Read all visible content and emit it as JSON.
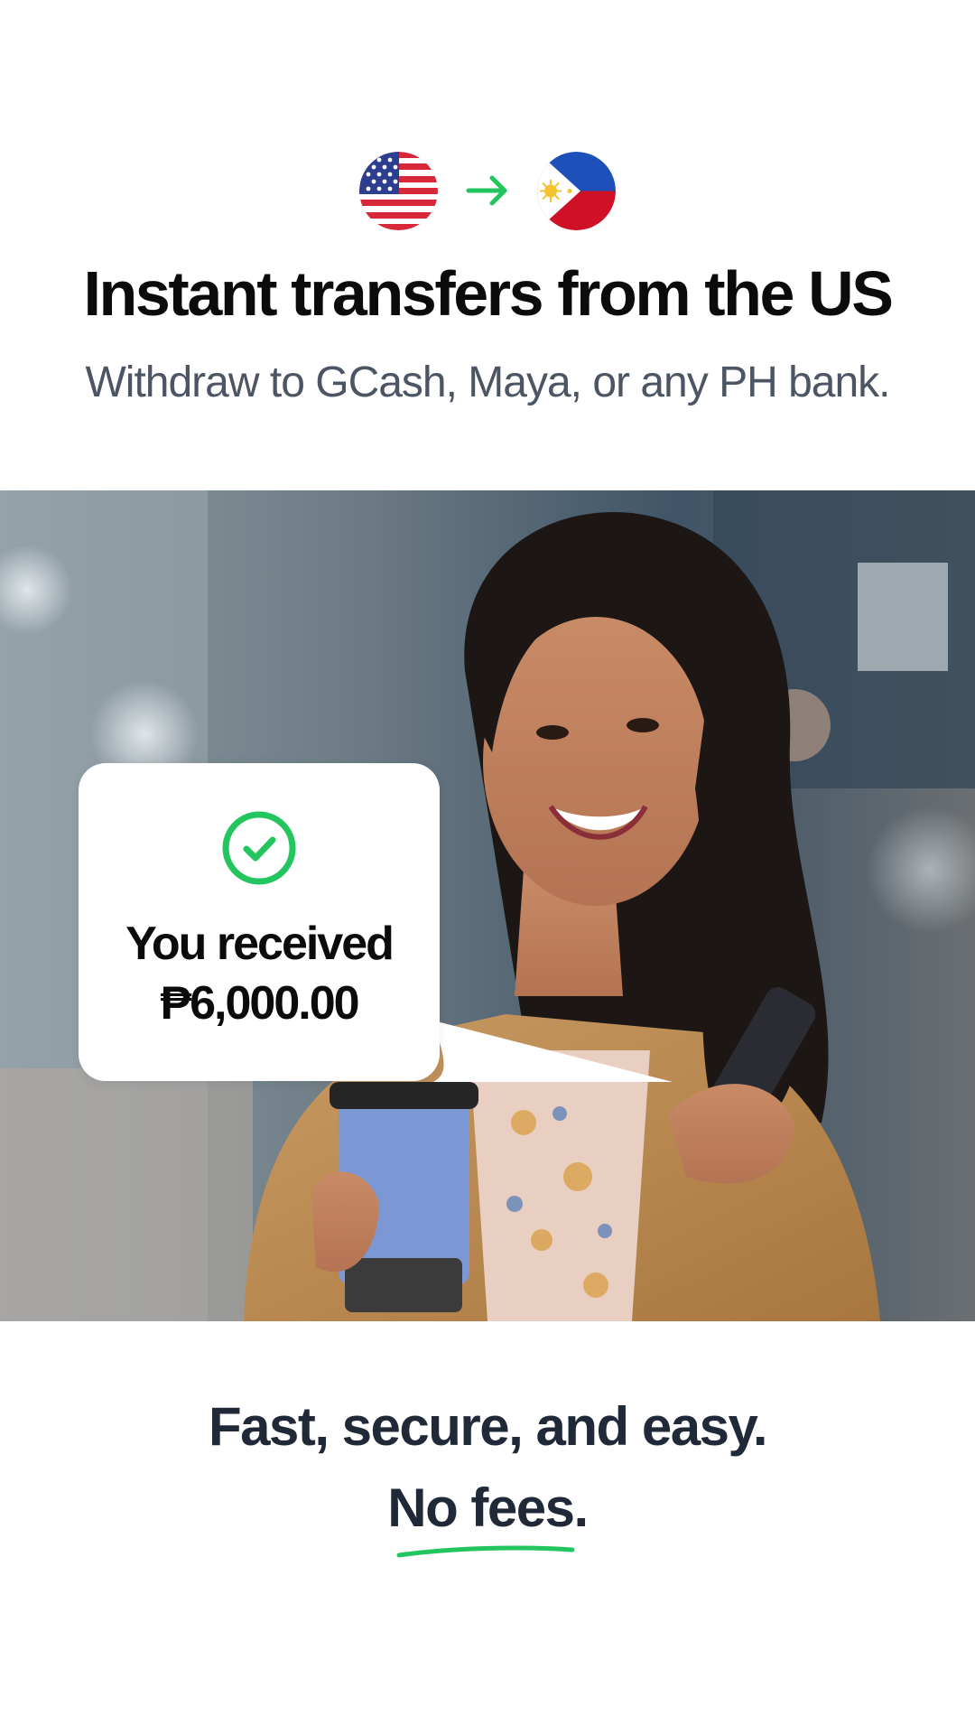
{
  "header": {
    "from_flag_icon": "us-flag-icon",
    "arrow_icon": "arrow-right-icon",
    "to_flag_icon": "philippines-flag-icon",
    "title": "Instant transfers from the US",
    "subtitle": "Withdraw to GCash, Maya, or any PH bank."
  },
  "notification": {
    "icon": "check-circle-icon",
    "line1": "You received",
    "line2": "₱6,000.00"
  },
  "footer": {
    "tagline": "Fast, secure, and easy.",
    "highlight": "No fees."
  },
  "colors": {
    "accent_green": "#22c55e",
    "headline": "#0b0b0b",
    "subtitle": "#4b5563",
    "footer_text": "#1f2937"
  }
}
